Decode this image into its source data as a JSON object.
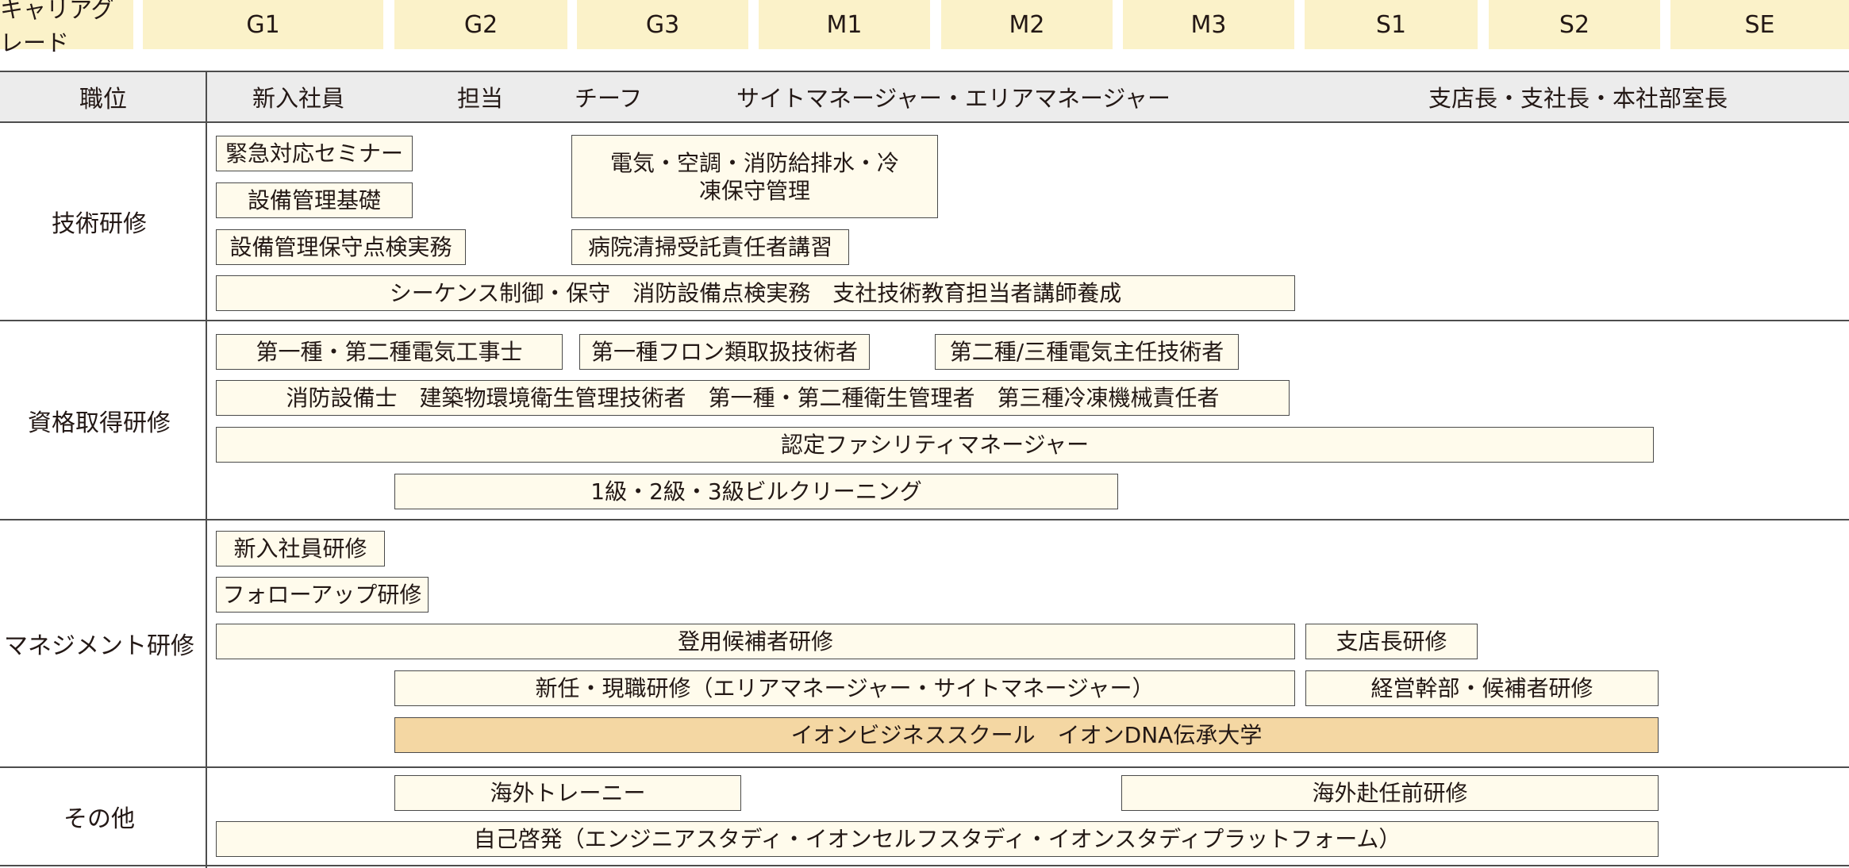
{
  "grades": {
    "title": "キャリアグレード",
    "items": [
      "G1",
      "G2",
      "G3",
      "M1",
      "M2",
      "M3",
      "S1",
      "S2",
      "SE"
    ]
  },
  "positions": {
    "label": "職位",
    "items": [
      "新入社員",
      "担当",
      "チーフ",
      "サイトマネージャー・エリアマネージャー",
      "支店長・支社長・本社部室長"
    ]
  },
  "sections": {
    "technical": {
      "label": "技術研修",
      "items": [
        "緊急対応セミナー",
        "設備管理基礎",
        "設備管理保守点検実務",
        "電気・空調・消防給排水・冷凍保守管理",
        "病院清掃受託責任者講習",
        "シーケンス制御・保守　消防設備点検実務　支社技術教育担当者講師養成"
      ]
    },
    "qualification": {
      "label": "資格取得研修",
      "items": [
        "第一種・第二種電気工事士",
        "第一種フロン類取扱技術者",
        "第二種/三種電気主任技術者",
        "消防設備士　建築物環境衛生管理技術者　第一種・第二種衛生管理者　第三種冷凍機械責任者",
        "認定ファシリティマネージャー",
        "1級・2級・3級ビルクリーニング"
      ]
    },
    "management": {
      "label": "マネジメント研修",
      "items": [
        "新入社員研修",
        "フォローアップ研修",
        "登用候補者研修",
        "支店長研修",
        "新任・現職研修（エリアマネージャー・サイトマネージャー）",
        "経営幹部・候補者研修",
        "イオンビジネススクール　イオンDNA伝承大学"
      ]
    },
    "other": {
      "label": "その他",
      "items": [
        "海外トレーニー",
        "海外赴任前研修",
        "自己啓発（エンジニアスタディ・イオンセルフスタディ・イオンスタディプラットフォーム）"
      ]
    }
  },
  "colors": {
    "grade_cell": "#fbf2c9",
    "box_fill": "#fffbec",
    "highlight_fill": "#f4d7a3",
    "header_row": "#ececec",
    "line": "#4d4d4d"
  }
}
